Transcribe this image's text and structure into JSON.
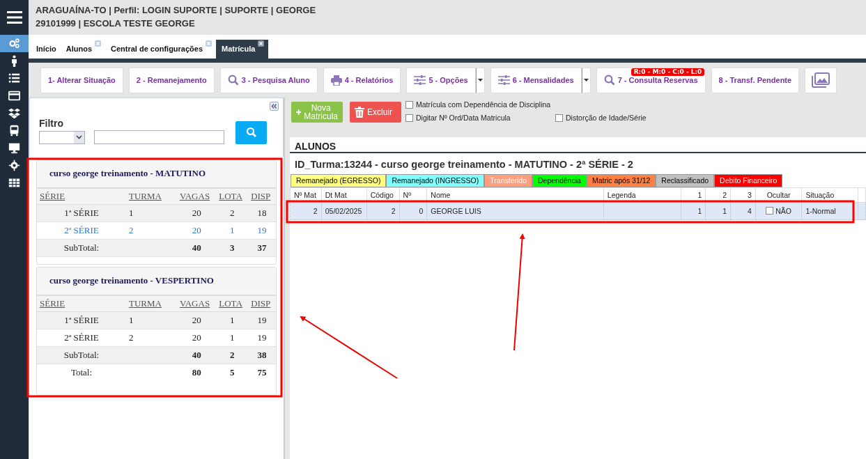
{
  "header": {
    "line_1": "ARAGUAÍNA-TO | Perfil: LOGIN SUPORTE | SUPORTE | GEORGE",
    "line_2": "29101999 | ESCOLA TESTE GEORGE"
  },
  "sidebar": {
    "items": [
      {
        "selected": true
      },
      {
        "selected": false
      },
      {
        "selected": false
      },
      {
        "selected": false
      },
      {
        "selected": false
      },
      {
        "selected": false
      },
      {
        "selected": false
      },
      {
        "selected": false
      },
      {
        "selected": false
      }
    ]
  },
  "tabs": [
    {
      "label": "Início",
      "selected": false,
      "closable": false
    },
    {
      "label": "Alunos",
      "selected": false,
      "closable": true
    },
    {
      "label": "Central de configurações",
      "selected": false,
      "closable": true
    },
    {
      "label": "Matrícula",
      "selected": true,
      "closable": true
    }
  ],
  "toolbar": [
    {
      "label": "1- Alterar Situação",
      "kind": "plain"
    },
    {
      "label": "2 - Remanejamento",
      "kind": "plain"
    },
    {
      "label": "3 - Pesquisa Aluno",
      "kind": "search"
    },
    {
      "label": "4 - Relatórios",
      "kind": "print"
    },
    {
      "label": "5 - Opções",
      "kind": "sliders",
      "dropdown": true
    },
    {
      "label": "6 - Mensalidades",
      "kind": "sliders",
      "dropdown": true
    },
    {
      "label": "7 - Consulta Reservas",
      "kind": "search",
      "badge": "R:0 - M:0 - C:0 - L:0"
    },
    {
      "label": "8 - Transf. Pendente",
      "kind": "plain"
    },
    {
      "kind": "image"
    }
  ],
  "filter": {
    "label": "Filtro"
  },
  "courses": [
    {
      "title": "curso george treinamento - MATUTINO",
      "columns": [
        "SÉRIE",
        "TURMA",
        "VAGAS",
        "LOTA",
        "DISP"
      ],
      "rows": [
        {
          "kind": "item",
          "selected": false,
          "cells": [
            "1ª SÉRIE",
            "1",
            "20",
            "2",
            "18"
          ]
        },
        {
          "kind": "item",
          "selected": true,
          "cells": [
            "2ª SÉRIE",
            "2",
            "20",
            "1",
            "19"
          ]
        },
        {
          "kind": "subtotal",
          "selected": false,
          "cells": [
            "SubTotal:",
            "",
            "40",
            "3",
            "37"
          ]
        }
      ]
    },
    {
      "title": "curso george treinamento - VESPERTINO",
      "columns": [
        "SÉRIE",
        "TURMA",
        "VAGAS",
        "LOTA",
        "DISP"
      ],
      "rows": [
        {
          "kind": "item",
          "selected": false,
          "cells": [
            "1ª SÉRIE",
            "1",
            "20",
            "1",
            "19"
          ]
        },
        {
          "kind": "item",
          "selected": false,
          "cells": [
            "2ª SÉRIE",
            "2",
            "20",
            "1",
            "19"
          ]
        },
        {
          "kind": "subtotal",
          "selected": false,
          "cells": [
            "SubTotal:",
            "",
            "40",
            "2",
            "38"
          ]
        },
        {
          "kind": "total",
          "selected": false,
          "cells": [
            "Total:",
            "",
            "80",
            "5",
            "75"
          ]
        }
      ]
    }
  ],
  "actions": [
    {
      "label": "Nova Matricula",
      "kind": "add"
    },
    {
      "label": "Excluir",
      "kind": "delete"
    }
  ],
  "options": [
    {
      "label": "Matrícula com Dependência de Disciplina",
      "checked": false
    },
    {
      "label": "Digitar Nº Ord/Data Matricula",
      "checked": false
    },
    {
      "label": "Distorção de Idade/Série",
      "checked": false
    }
  ],
  "students": {
    "title": "ALUNOS",
    "class_heading": "ID_Turma:13244 - curso george treinamento - MATUTINO - 2ª SÉRIE - 2",
    "legend": [
      {
        "label": "Remanejado (EGRESSO)",
        "color": "#ffff80"
      },
      {
        "label": "Remanejado (INGRESSO)",
        "color": "#80ffff"
      },
      {
        "label": "Transferido",
        "color": "#ff9f80"
      },
      {
        "label": "Dependência",
        "color": "#00ff00"
      },
      {
        "label": "Matric após 31/12",
        "color": "#ff8040"
      },
      {
        "label": "Reclassificado",
        "color": "#c0c0c0"
      },
      {
        "label": "Debito Financeiro",
        "color": "#ff0000"
      }
    ],
    "columns": [
      "Nº Mat",
      "Dt Mat",
      "Código",
      "Nº",
      "Nome",
      "Legenda",
      "1",
      "2",
      "3",
      "Ocultar",
      "Situação"
    ],
    "rows": [
      {
        "selected": true,
        "hidden_checked": false,
        "cells": [
          "2",
          "05/02/2025",
          "2",
          "0",
          "GEORGE LUIS",
          "",
          "1",
          "1",
          "4",
          "NÃO",
          "1-Normal"
        ]
      }
    ]
  }
}
